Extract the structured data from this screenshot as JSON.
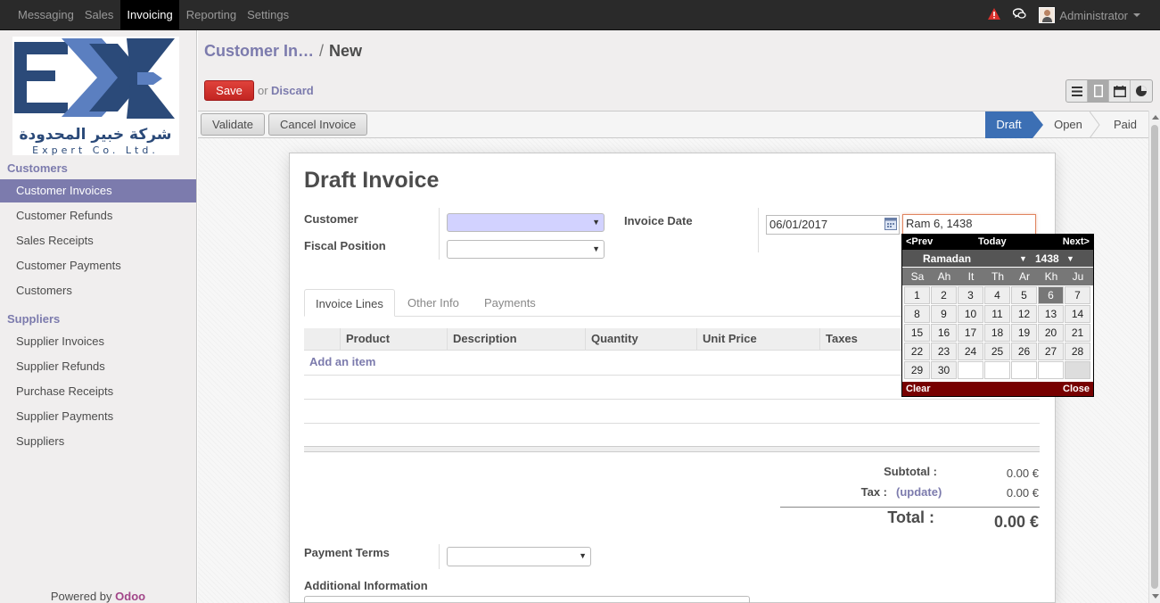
{
  "topbar": {
    "menu": [
      "Messaging",
      "Sales",
      "Invoicing",
      "Reporting",
      "Settings"
    ],
    "active_menu": "Invoicing",
    "user": "Administrator"
  },
  "sidebar": {
    "customers_title": "Customers",
    "customer_items": [
      "Customer Invoices",
      "Customer Refunds",
      "Sales Receipts",
      "Customer Payments",
      "Customers"
    ],
    "suppliers_title": "Suppliers",
    "supplier_items": [
      "Supplier Invoices",
      "Supplier Refunds",
      "Purchase Receipts",
      "Supplier Payments",
      "Suppliers"
    ],
    "powered_by": "Powered by",
    "powered_brand": "Odoo",
    "logo_arabic": "شركة خبير المحدودة",
    "logo_english": "Expert Co. Ltd."
  },
  "header": {
    "crumb_parent": "Customer In…",
    "crumb_sep": "/",
    "crumb_current": "New",
    "save": "Save",
    "or": "or",
    "discard": "Discard"
  },
  "statusbar": {
    "validate": "Validate",
    "cancel_invoice": "Cancel Invoice",
    "stages": [
      "Draft",
      "Open",
      "Paid"
    ],
    "active_stage": "Draft"
  },
  "form": {
    "title": "Draft Invoice",
    "customer_label": "Customer",
    "fiscal_label": "Fiscal Position",
    "invoice_date_label": "Invoice Date",
    "invoice_date_value": "06/01/2017",
    "hijri_date_value": "Ram 6, 1438",
    "tabs": [
      "Invoice Lines",
      "Other Info",
      "Payments"
    ],
    "columns": [
      "Product",
      "Description",
      "Quantity",
      "Unit Price",
      "Taxes"
    ],
    "add_item": "Add an item",
    "subtotal_label": "Subtotal :",
    "subtotal_value": "0.00 €",
    "tax_label": "Tax :",
    "tax_update": "(update)",
    "tax_value": "0.00 €",
    "total_label": "Total :",
    "total_value": "0.00 €",
    "payment_terms_label": "Payment Terms",
    "additional_info_label": "Additional Information"
  },
  "datepicker": {
    "prev": "<Prev",
    "today": "Today",
    "next": "Next>",
    "month": "Ramadan",
    "year": "1438",
    "day_names": [
      "Sa",
      "Ah",
      "It",
      "Th",
      "Ar",
      "Kh",
      "Ju"
    ],
    "weeks": [
      [
        "1",
        "2",
        "3",
        "4",
        "5",
        "6",
        "7"
      ],
      [
        "8",
        "9",
        "10",
        "11",
        "12",
        "13",
        "14"
      ],
      [
        "15",
        "16",
        "17",
        "18",
        "19",
        "20",
        "21"
      ],
      [
        "22",
        "23",
        "24",
        "25",
        "26",
        "27",
        "28"
      ],
      [
        "29",
        "30",
        "",
        "",
        "",
        "",
        ""
      ]
    ],
    "selected": "6",
    "clear": "Clear",
    "close": "Close"
  },
  "colors": {
    "accent": "#7c7bad",
    "save": "#d9312c",
    "stage_active": "#3c6fb4",
    "dp_footer": "#770000"
  }
}
